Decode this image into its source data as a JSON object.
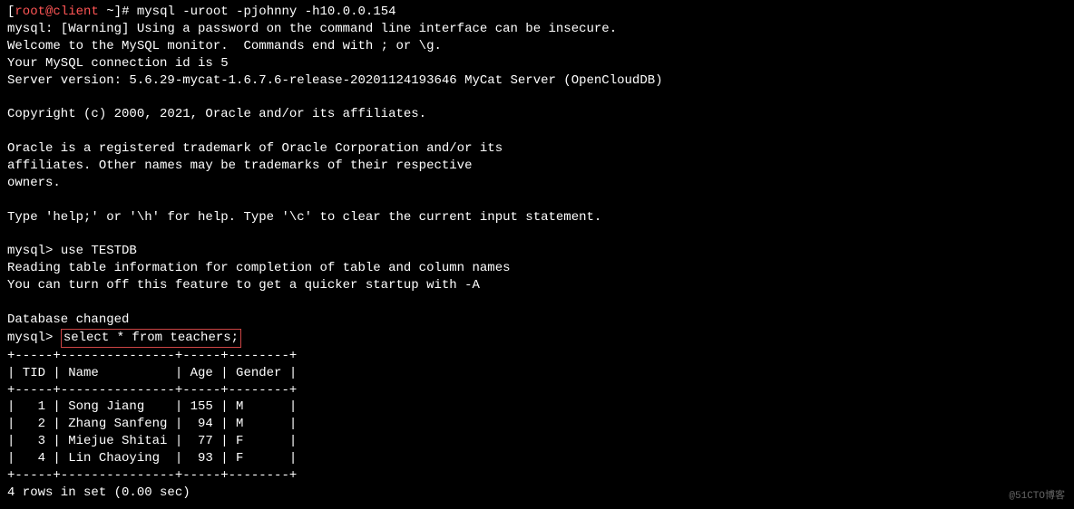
{
  "prompt": {
    "bracket_open": "[",
    "user": "root",
    "at": "@",
    "host": "client",
    "path": " ~",
    "bracket_close": "]",
    "hash": "# "
  },
  "command": "mysql -uroot -pjohnny -h10.0.0.154",
  "output_lines": {
    "warning": "mysql: [Warning] Using a password on the command line interface can be insecure.",
    "welcome": "Welcome to the MySQL monitor.  Commands end with ; or \\g.",
    "connection_id": "Your MySQL connection id is 5",
    "server_version": "Server version: 5.6.29-mycat-1.6.7.6-release-20201124193646 MyCat Server (OpenCloudDB)",
    "copyright": "Copyright (c) 2000, 2021, Oracle and/or its affiliates.",
    "trademark1": "Oracle is a registered trademark of Oracle Corporation and/or its",
    "trademark2": "affiliates. Other names may be trademarks of their respective",
    "trademark3": "owners.",
    "help": "Type 'help;' or '\\h' for help. Type '\\c' to clear the current input statement."
  },
  "mysql_prompt": "mysql> ",
  "use_command": "use TESTDB",
  "use_output": {
    "reading": "Reading table information for completion of table and column names",
    "turnoff": "You can turn off this feature to get a quicker startup with -A",
    "changed": "Database changed"
  },
  "select_command": "select * from teachers;",
  "table": {
    "border_top": "+-----+---------------+-----+--------+",
    "header": "| TID | Name          | Age | Gender |",
    "border_mid": "+-----+---------------+-----+--------+",
    "rows": [
      "|   1 | Song Jiang    | 155 | M      |",
      "|   2 | Zhang Sanfeng |  94 | M      |",
      "|   3 | Miejue Shitai |  77 | F      |",
      "|   4 | Lin Chaoying  |  93 | F      |"
    ],
    "border_bottom": "+-----+---------------+-----+--------+"
  },
  "result_summary": "4 rows in set (0.00 sec)",
  "chart_data": {
    "type": "table",
    "title": "teachers",
    "columns": [
      "TID",
      "Name",
      "Age",
      "Gender"
    ],
    "rows": [
      {
        "TID": 1,
        "Name": "Song Jiang",
        "Age": 155,
        "Gender": "M"
      },
      {
        "TID": 2,
        "Name": "Zhang Sanfeng",
        "Age": 94,
        "Gender": "M"
      },
      {
        "TID": 3,
        "Name": "Miejue Shitai",
        "Age": 77,
        "Gender": "F"
      },
      {
        "TID": 4,
        "Name": "Lin Chaoying",
        "Age": 93,
        "Gender": "F"
      }
    ]
  },
  "watermark": "@51CTO博客"
}
